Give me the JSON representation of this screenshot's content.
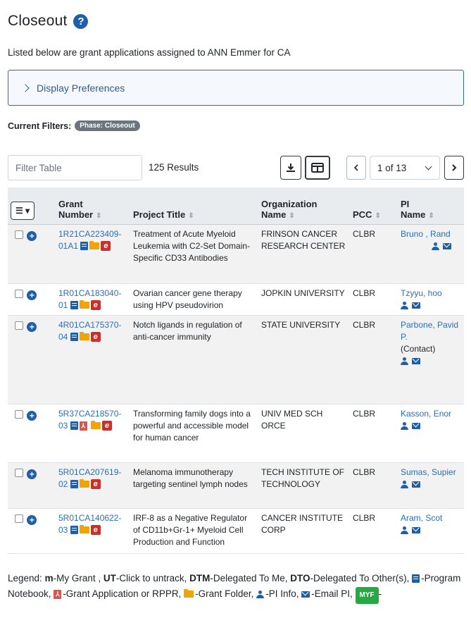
{
  "page": {
    "title": "Closeout",
    "subtitle": "Listed below are grant applications  assigned to ANN Emmer for CA",
    "prefs_label": "Display Preferences",
    "current_filters_label": "Current Filters:",
    "filter_chip": "Phase: Closeout"
  },
  "toolbar": {
    "filter_placeholder": "Filter Table",
    "results": "125 Results",
    "page_indicator": "1 of 13"
  },
  "columns": {
    "grant_l1": "Grant",
    "grant_l2": "Number",
    "title": "Project Title",
    "org_l1": "Organization",
    "org_l2": "Name",
    "pcc": "PCC",
    "pi_l1": "PI",
    "pi_l2": "Name"
  },
  "rows": [
    {
      "grant_a": "1R21CA223409-",
      "grant_b": "01A1",
      "title": "Treatment of Acute Myeloid Leukemia with C2-Set Domain-Specific CD33 Antibodies",
      "org": "FRINSON CANCER RESEARCH CENTER",
      "pcc": "CLBR",
      "pi": "Bruno , Rand",
      "pi_extra": ""
    },
    {
      "grant_a": "1R01CA183040-",
      "grant_b": "01",
      "title": "Ovarian cancer gene therapy using HPV pseudovirion",
      "org": "JOPKIN UNIVERSITY",
      "pcc": "CLBR",
      "pi": "Tzyyu, hoo",
      "pi_extra": ""
    },
    {
      "grant_a": "4R01CA175370-",
      "grant_b": "04",
      "title": "Notch ligands in regulation of anti-cancer immunity",
      "org": "STATE UNIVERSITY",
      "pcc": "CLBR",
      "pi": "Parbone, Pavid P.",
      "pi_extra": "(Contact)"
    },
    {
      "grant_a": "5R37CA218570-",
      "grant_b": "03",
      "title": "Transforming family dogs into a powerful and accessible model for human cancer",
      "org": "UNIV MED SCH ORCE",
      "pcc": "CLBR",
      "pi": "Kasson, Enor",
      "pi_extra": ""
    },
    {
      "grant_a": "5R01CA207619-",
      "grant_b": "02",
      "title": "Melanoma immunotherapy targeting sentinel lymph nodes",
      "org": "TECH INSTITUTE OF TECHNOLOGY",
      "pcc": "CLBR",
      "pi": "Sumas, Supier",
      "pi_extra": ""
    },
    {
      "grant_a": "5R01CA140622-",
      "grant_b": "03",
      "title": "IRF-8 as a Negative Regulator of CD11b+Gr-1+ Myeloid Cell Production and Function",
      "org": "CANCER INSTITUTE CORP",
      "pcc": "CLBR",
      "pi": "Aram, Scot",
      "pi_extra": ""
    }
  ],
  "legend": {
    "label": "Legend:",
    "m_key": "m",
    "m_text": "-My Grant ,",
    "ut_key": "UT",
    "ut_text": "-Click to untrack,",
    "dtm_key": "DTM",
    "dtm_text": "-Delegated To Me,",
    "dto_key": "DTO",
    "dto_text": "-Delegated To Other(s),",
    "nb_text": "-Program Notebook,",
    "pdf_text": "-Grant Application or RPPR,",
    "folder_text": "-Grant Folder,",
    "pi_text": "-PI Info,",
    "mail_text": "-Email PI,",
    "myf_badge": "MYF",
    "myf_text": "-"
  }
}
